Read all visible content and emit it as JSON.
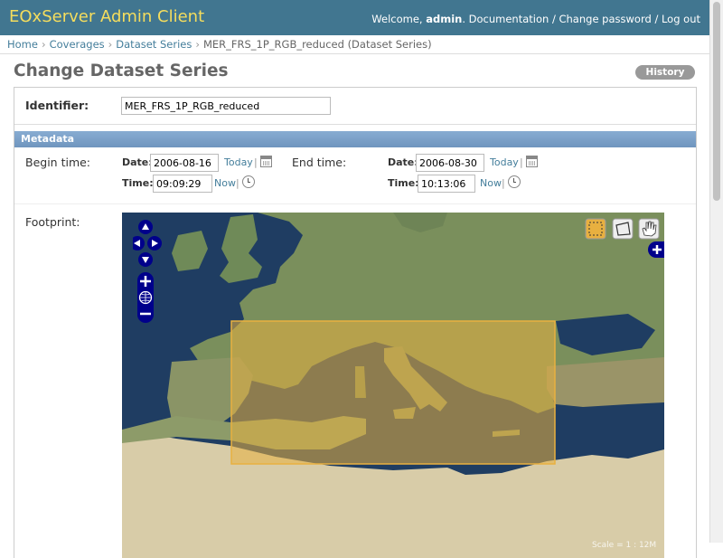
{
  "header": {
    "brand": "EOxServer Admin Client",
    "welcome_prefix": "Welcome,",
    "username": "admin",
    "links": [
      "Documentation",
      "Change password",
      "Log out"
    ],
    "separator": "/"
  },
  "breadcrumbs": {
    "items": [
      "Home",
      "Coverages",
      "Dataset Series"
    ],
    "current": "MER_FRS_1P_RGB_reduced (Dataset Series)",
    "separator": "›"
  },
  "page": {
    "title": "Change Dataset Series",
    "history_label": "History"
  },
  "form": {
    "identifier_label": "Identifier:",
    "identifier_value": "MER_FRS_1P_RGB_reduced",
    "metadata_header": "Metadata",
    "begin_time": {
      "label": "Begin time:",
      "date_label": "Date:",
      "date_value": "2006-08-16",
      "today_link": "Today",
      "time_label": "Time:",
      "time_value": "09:09:29",
      "now_link": "Now"
    },
    "end_time": {
      "label": "End time:",
      "date_label": "Date:",
      "date_value": "2006-08-30",
      "today_link": "Today",
      "time_label": "Time:",
      "time_value": "10:13:06",
      "now_link": "Now"
    },
    "pipe": "|",
    "footprint_label": "Footprint:"
  },
  "map": {
    "footprint_color": "#e8b040",
    "sea_color": "#1d3a5f",
    "land_color": "#7c8a5a",
    "desert_color": "#d8cca8",
    "nav_color": "#00008b",
    "scale_text": "Scale = 1 : 12M",
    "controls": [
      "pan-up",
      "pan-left",
      "pan-right",
      "pan-down",
      "zoom-in",
      "zoom-world",
      "zoom-out"
    ],
    "editing_tools": [
      "draw-polygon",
      "modify-feature",
      "navigate-hand"
    ]
  }
}
